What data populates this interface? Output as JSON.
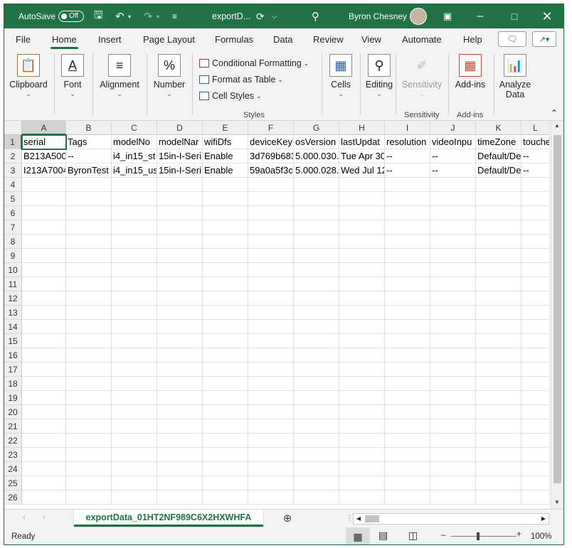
{
  "titlebar": {
    "autosave_label": "AutoSave",
    "autosave_state": "Off",
    "filename": "exportD...",
    "user_name": "Byron Chesney"
  },
  "tabs": [
    "File",
    "Home",
    "Insert",
    "Page Layout",
    "Formulas",
    "Data",
    "Review",
    "View",
    "Automate",
    "Help"
  ],
  "active_tab": "Home",
  "ribbon": {
    "clipboard": "Clipboard",
    "font": "Font",
    "alignment": "Alignment",
    "number": "Number",
    "conditional_formatting": "Conditional Formatting",
    "format_as_table": "Format as Table",
    "cell_styles": "Cell Styles",
    "styles_group": "Styles",
    "cells": "Cells",
    "editing": "Editing",
    "sensitivity": "Sensitivity",
    "sensitivity_group": "Sensitivity",
    "addins": "Add-ins",
    "addins_group": "Add-ins",
    "analyze_line1": "Analyze",
    "analyze_line2": "Data"
  },
  "sheet": {
    "columns": [
      "A",
      "B",
      "C",
      "D",
      "E",
      "F",
      "G",
      "H",
      "I",
      "J",
      "K",
      "L"
    ],
    "rows": [
      "1",
      "2",
      "3",
      "4",
      "5",
      "6",
      "7",
      "8",
      "9",
      "10",
      "11",
      "12",
      "13",
      "14",
      "15",
      "16",
      "17",
      "18",
      "19",
      "20",
      "21",
      "22",
      "23",
      "24",
      "25",
      "26"
    ],
    "data": [
      [
        "serial",
        "Tags",
        "modelNo",
        "modelNar",
        "wifiDfs",
        "deviceKey",
        "osVersion",
        "lastUpdat",
        "resolution",
        "videoInpu",
        "timeZone",
        "touche"
      ],
      [
        "B213A500",
        "--",
        "i4_in15_st",
        "15in-I-Seri",
        "Enable",
        "3d769b683",
        "5.000.030.",
        "Tue Apr 30",
        "--",
        "--",
        "Default/De",
        "--"
      ],
      [
        "I213A7004",
        "ByronTest",
        "i4_in15_us",
        "15in-I-Seri",
        "Enable",
        "59a0a5f3c",
        "5.000.028.",
        "Wed Jul 12",
        "--",
        "--",
        "Default/De",
        "--"
      ]
    ]
  },
  "sheet_tab": "exportData_01HT2NF989C6X2HXWHFA",
  "status": {
    "ready": "Ready",
    "zoom": "100%"
  }
}
